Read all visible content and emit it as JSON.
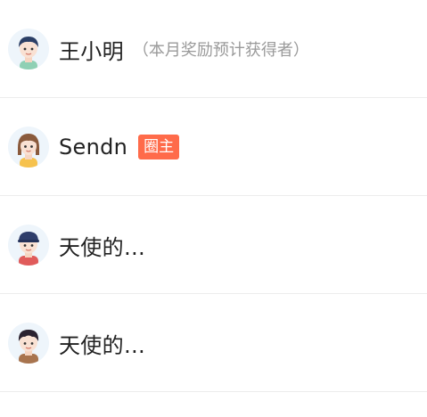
{
  "members": [
    {
      "name": "王小明",
      "note": "（本月奖励预计获得者）",
      "badge": "",
      "avatar_icon": "boy-avatar-icon"
    },
    {
      "name": "Sendn",
      "note": "",
      "badge": "圈主",
      "avatar_icon": "girl-avatar-icon"
    },
    {
      "name": "天使的…",
      "note": "",
      "badge": "",
      "avatar_icon": "boy-cap-avatar-icon"
    },
    {
      "name": "天使的…",
      "note": "",
      "badge": "",
      "avatar_icon": "boy-avatar-icon"
    }
  ],
  "colors": {
    "badge": "#ff6b4a",
    "divider": "#ececec",
    "name": "#222222",
    "note": "#9a9a9a"
  }
}
